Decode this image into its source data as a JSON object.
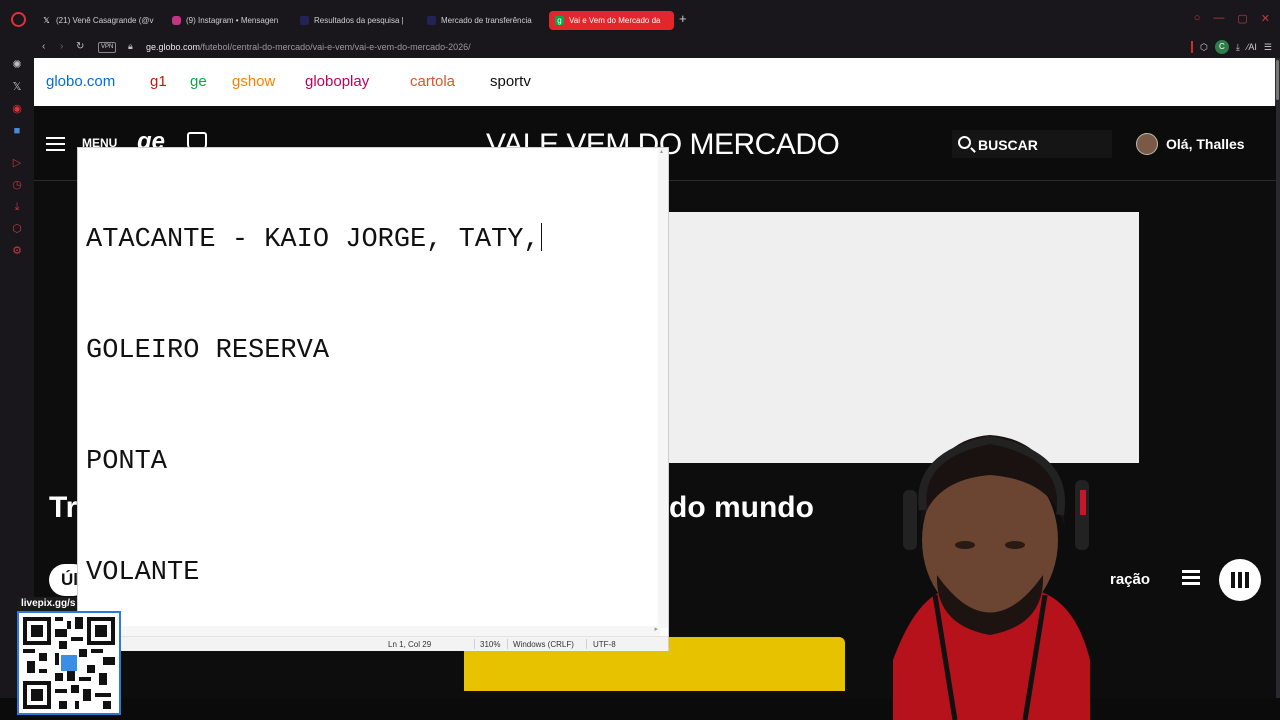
{
  "browser": {
    "tabs": [
      {
        "title": "(21) Venê Casagrande (@v",
        "icon": "x-icon",
        "active": false
      },
      {
        "title": "(9) Instagram • Mensagen",
        "icon": "instagram-icon",
        "active": false
      },
      {
        "title": "Resultados da pesquisa |",
        "icon": "site-icon",
        "active": false
      },
      {
        "title": "Mercado de transferência",
        "icon": "site-icon",
        "active": false
      },
      {
        "title": "Vai e Vem do Mercado da",
        "icon": "ge-icon",
        "active": true
      }
    ],
    "vpn_label": "VPN",
    "url_host": "ge.globo.com",
    "url_path": "/futebol/central-do-mercado/vai-e-vem/vai-e-vem-do-mercado-2026/",
    "profile_badge": "C",
    "ai_label": "AI"
  },
  "globo_nav": {
    "items": [
      {
        "label": "globo.com",
        "color": "#0669de"
      },
      {
        "label": "g1",
        "color": "#c4170c"
      },
      {
        "label": "ge",
        "color": "#06aa48"
      },
      {
        "label": "gshow",
        "color": "#ff7f00"
      },
      {
        "label": "globoplay",
        "color": "#c3005a"
      },
      {
        "label": "cartola",
        "color": "#d6582a"
      },
      {
        "label": "sportv",
        "color": "#111111"
      }
    ]
  },
  "ge_header": {
    "menu_label": "MENU",
    "logo": "ge",
    "section_title": "VALE VEM DO MERCADO",
    "search_label": "BUSCAR",
    "greeting": "Olá, Thalles"
  },
  "page": {
    "headline_left": "Tr",
    "headline_right": "do mundo",
    "pill_left": "Úl",
    "filter_text": "ração"
  },
  "notepad": {
    "lines": [
      "ATACANTE - KAIO JORGE, TATY,",
      "GOLEIRO RESERVA",
      "PONTA",
      "VOLANTE"
    ],
    "status": {
      "position": "Ln 1, Col 29",
      "zoom": "310%",
      "line_ending": "Windows (CRLF)",
      "encoding": "UTF-8"
    }
  },
  "overlay": {
    "qr_label": "livepix.gg/s"
  },
  "colors": {
    "accent_red": "#e2262b",
    "ge_dark": "#0c0c0c",
    "banner_yellow": "#e6c200"
  }
}
